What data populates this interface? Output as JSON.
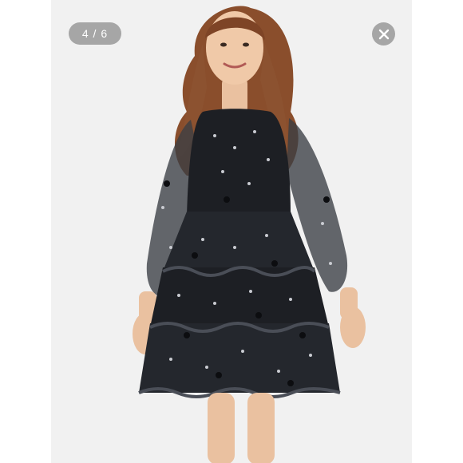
{
  "viewer": {
    "counter": {
      "current": "4",
      "separator": " / ",
      "total": "6"
    },
    "close_icon": "close-icon",
    "photo": {
      "subject": "product-photo",
      "background_color": "#f1f1f1"
    },
    "colors": {
      "pill_bg": "#7a7a7a",
      "dress": "#1d1f24",
      "sequin": "#c9cbd1"
    }
  }
}
